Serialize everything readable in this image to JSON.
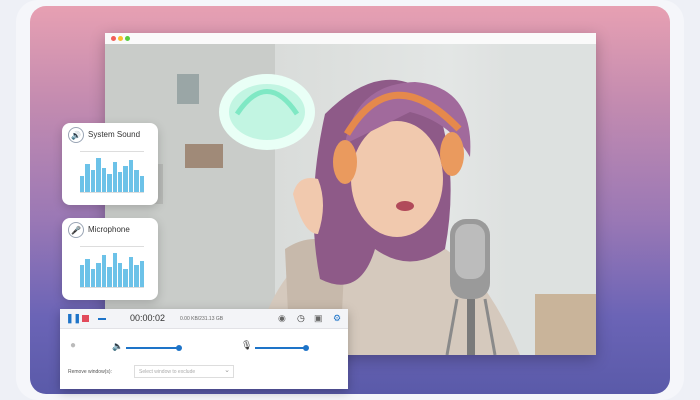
{
  "panels": {
    "system_sound": {
      "title": "System Sound",
      "icon": "speaker-icon"
    },
    "microphone": {
      "title": "Microphone",
      "icon": "microphone-icon"
    }
  },
  "recorder": {
    "timer": "00:00:02",
    "size": "0.00 KB/231.13 GB",
    "remove_window_label": "Remove window(s):",
    "remove_window_placeholder": "Select window to exclude",
    "system_volume": 0.85,
    "mic_volume": 0.85,
    "accent_color": "#1e74c8"
  }
}
